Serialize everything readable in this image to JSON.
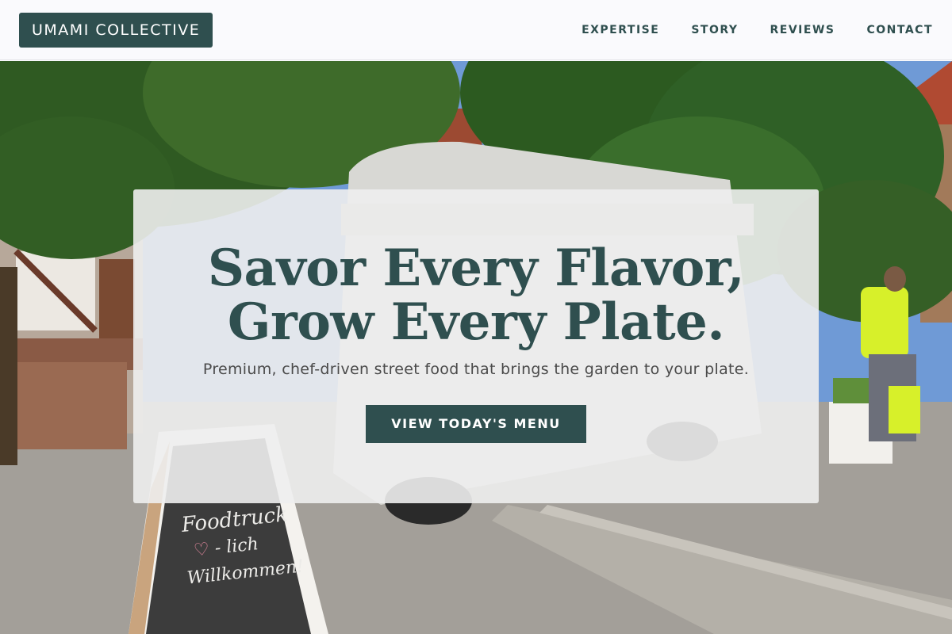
{
  "brand": {
    "name": "UMAMI COLLECTIVE"
  },
  "nav": {
    "items": [
      {
        "label": "EXPERTISE"
      },
      {
        "label": "STORY"
      },
      {
        "label": "REVIEWS"
      },
      {
        "label": "CONTACT"
      }
    ]
  },
  "hero": {
    "headline_line1": "Savor Every Flavor,",
    "headline_line2": "Grow Every Plate.",
    "subtitle": "Premium, chef-driven street food that brings the garden to your plate.",
    "cta_label": "VIEW TODAY'S MENU",
    "chalkboard_line1": "Foodtruck",
    "chalkboard_line2": "- lich",
    "chalkboard_line3": "Willkommen!"
  },
  "colors": {
    "accent": "#2f4f4f",
    "nav_background": "#fafafd",
    "card_background": "#eeeeee"
  }
}
